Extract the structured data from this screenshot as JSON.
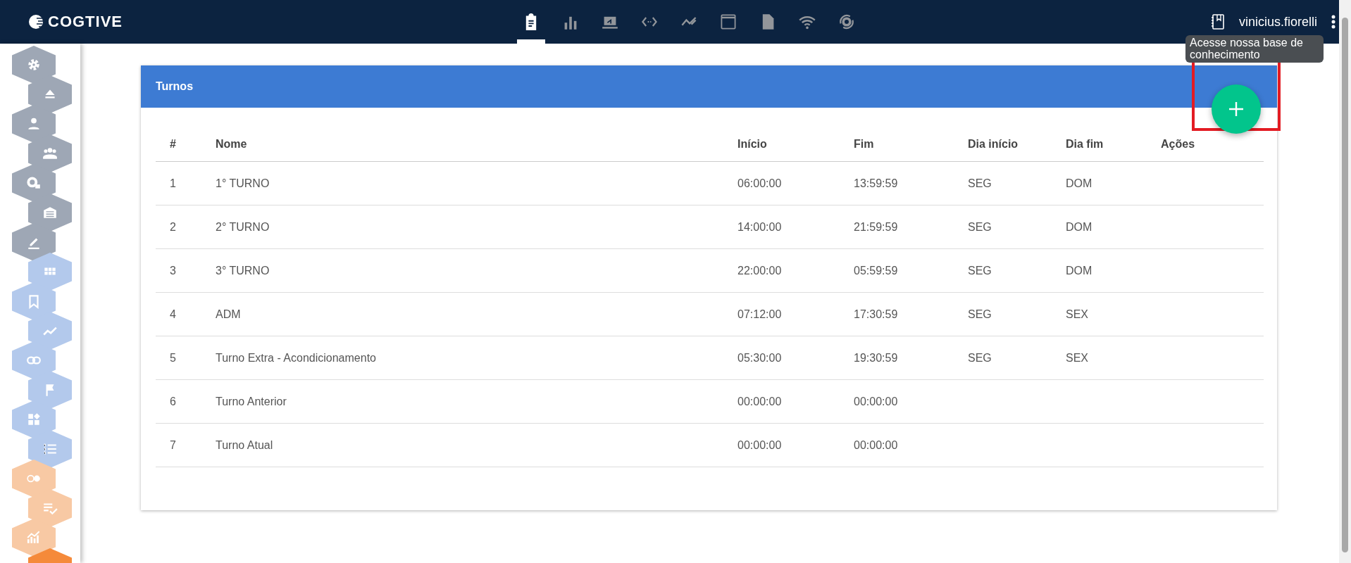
{
  "app": {
    "logo": "COGTIVE",
    "user": "vinicius.fiorelli",
    "tooltip": "Acesse nossa base de conhecimento"
  },
  "nav_icons": [
    {
      "selected": true
    },
    {
      "selected": false
    },
    {
      "selected": false
    },
    {
      "selected": false
    },
    {
      "selected": false
    },
    {
      "selected": false
    },
    {
      "selected": false
    },
    {
      "selected": false
    },
    {
      "selected": false
    }
  ],
  "sidebar": {
    "items": [
      {
        "color": "#9ea7b5"
      },
      {
        "color": "#9ea7b5"
      },
      {
        "color": "#9ea7b5"
      },
      {
        "color": "#9ea7b5"
      },
      {
        "color": "#9ea7b5"
      },
      {
        "color": "#9ea7b5"
      },
      {
        "color": "#9ea7b5"
      },
      {
        "color": "#b3c9ec"
      },
      {
        "color": "#b3c9ec"
      },
      {
        "color": "#b3c9ec"
      },
      {
        "color": "#b3c9ec"
      },
      {
        "color": "#b3c9ec"
      },
      {
        "color": "#b3c9ec"
      },
      {
        "color": "#b3c9ec"
      },
      {
        "color": "#f8c9a4"
      },
      {
        "color": "#f8c9a4"
      },
      {
        "color": "#f8c9a4"
      },
      {
        "color": "#f58a3a"
      }
    ]
  },
  "panel": {
    "title": "Turnos",
    "table": {
      "columns": [
        "#",
        "Nome",
        "Início",
        "Fim",
        "Dia início",
        "Dia fim",
        "Ações"
      ],
      "rows": [
        [
          "1",
          "1° TURNO",
          "06:00:00",
          "13:59:59",
          "SEG",
          "DOM",
          ""
        ],
        [
          "2",
          "2° TURNO",
          "14:00:00",
          "21:59:59",
          "SEG",
          "DOM",
          ""
        ],
        [
          "3",
          "3° TURNO",
          "22:00:00",
          "05:59:59",
          "SEG",
          "DOM",
          ""
        ],
        [
          "4",
          "ADM",
          "07:12:00",
          "17:30:59",
          "SEG",
          "SEX",
          ""
        ],
        [
          "5",
          "Turno Extra - Acondicionamento",
          "05:30:00",
          "19:30:59",
          "SEG",
          "SEX",
          ""
        ],
        [
          "6",
          "Turno Anterior",
          "00:00:00",
          "00:00:00",
          "",
          "",
          ""
        ],
        [
          "7",
          "Turno Atual",
          "00:00:00",
          "00:00:00",
          "",
          "",
          ""
        ]
      ]
    }
  }
}
